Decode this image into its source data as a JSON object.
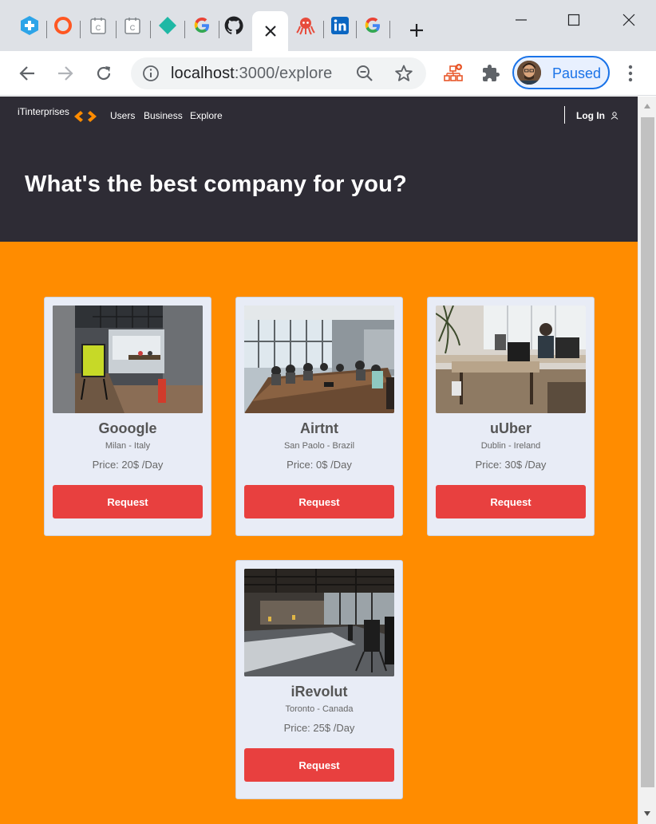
{
  "browser": {
    "tabs": [
      {
        "icon": "medical-cross-icon",
        "color": "#2da4e8"
      },
      {
        "icon": "ring-icon",
        "color": "#ff5722"
      },
      {
        "icon": "calendar-c-icon",
        "color": "#5f6368"
      },
      {
        "icon": "calendar-c-icon",
        "color": "#5f6368"
      },
      {
        "icon": "diamond-icon",
        "color": "#1fb8a5"
      },
      {
        "icon": "google-icon",
        "color": "#4285f4"
      },
      {
        "icon": "github-icon",
        "color": "#202124"
      }
    ],
    "active_tab": {
      "icon": "close-icon"
    },
    "tabs_after": [
      {
        "icon": "octopus-icon",
        "color": "#e74c3c"
      },
      {
        "icon": "linkedin-icon",
        "color": "#0a66c2"
      },
      {
        "icon": "google-icon",
        "color": "#4285f4"
      }
    ],
    "url_host": "localhost",
    "url_rest": ":3000/explore",
    "profile_label": "Paused"
  },
  "header": {
    "brand": "iTinterprises",
    "nav": {
      "users": "Users",
      "business": "Business",
      "explore": "Explore"
    },
    "login": "Log In",
    "hero_title": "What's the best company for you?"
  },
  "companies": [
    {
      "name": "Gooogle",
      "location": "Milan - Italy",
      "price": "Price: 20$ /Day",
      "button": "Request"
    },
    {
      "name": "Airtnt",
      "location": "San Paolo - Brazil",
      "price": "Price: 0$ /Day",
      "button": "Request"
    },
    {
      "name": "uUber",
      "location": "Dublin - Ireland",
      "price": "Price: 30$ /Day",
      "button": "Request"
    },
    {
      "name": "iRevolut",
      "location": "Toronto - Canada",
      "price": "Price: 25$ /Day",
      "button": "Request"
    }
  ],
  "colors": {
    "header_bg": "#2e2c35",
    "page_bg": "#ff8c00",
    "card_bg": "#e8ecf6",
    "button": "#e8403f",
    "logo_accent": "#ff8c00"
  }
}
